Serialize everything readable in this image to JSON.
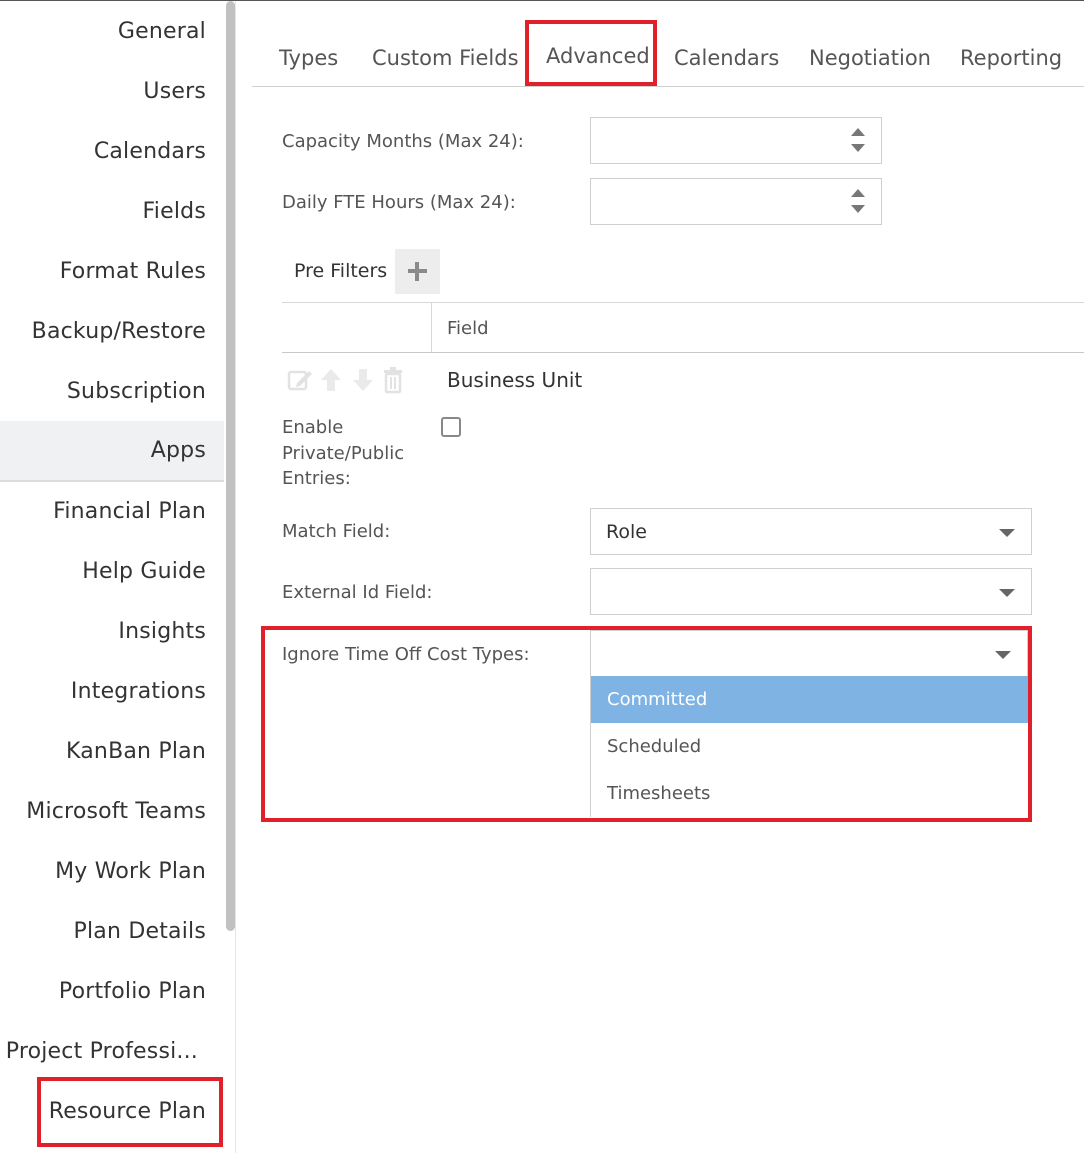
{
  "sidebar": {
    "items": [
      {
        "label": "General"
      },
      {
        "label": "Users"
      },
      {
        "label": "Calendars"
      },
      {
        "label": "Fields"
      },
      {
        "label": "Format Rules"
      },
      {
        "label": "Backup/Restore"
      },
      {
        "label": "Subscription"
      },
      {
        "label": "Apps"
      },
      {
        "label": "Financial Plan"
      },
      {
        "label": "Help Guide"
      },
      {
        "label": "Insights"
      },
      {
        "label": "Integrations"
      },
      {
        "label": "KanBan Plan"
      },
      {
        "label": "Microsoft Teams"
      },
      {
        "label": "My Work Plan"
      },
      {
        "label": "Plan Details"
      },
      {
        "label": "Portfolio Plan"
      },
      {
        "label": "Project Professi..."
      },
      {
        "label": "Resource Plan"
      }
    ]
  },
  "tabs": [
    {
      "label": "Types"
    },
    {
      "label": "Custom Fields"
    },
    {
      "label": "Advanced"
    },
    {
      "label": "Calendars"
    },
    {
      "label": "Negotiation"
    },
    {
      "label": "Reporting"
    }
  ],
  "form": {
    "capacity_months": {
      "label": "Capacity Months (Max 24):",
      "value": ""
    },
    "daily_fte_hours": {
      "label": "Daily FTE Hours (Max 24):",
      "value": ""
    },
    "pre_filters": {
      "label": "Pre Filters",
      "column_header": "Field",
      "rows": [
        {
          "field": "Business Unit"
        }
      ]
    },
    "enable_private_public": {
      "label_line1": "Enable",
      "label_line2": "Private/Public",
      "label_line3": "Entries:",
      "checked": false
    },
    "match_field": {
      "label": "Match Field:",
      "value": "Role"
    },
    "external_id_field": {
      "label": "External Id Field:",
      "value": ""
    },
    "ignore_time_off": {
      "label": "Ignore Time Off Cost Types:",
      "value": "",
      "options": [
        {
          "label": "Committed",
          "highlighted": true
        },
        {
          "label": "Scheduled",
          "highlighted": false
        },
        {
          "label": "Timesheets",
          "highlighted": false
        }
      ]
    }
  },
  "colors": {
    "highlight_box": "#e0202b",
    "selected_option": "#7fb3e4"
  }
}
